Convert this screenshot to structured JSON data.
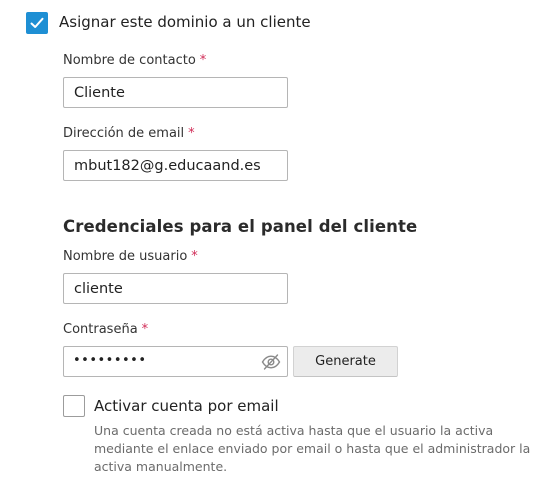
{
  "assign_client": {
    "checked": true,
    "label": "Asignar este dominio a un cliente"
  },
  "required_mark": "*",
  "contact_name": {
    "label": "Nombre de contacto",
    "value": "Cliente"
  },
  "email": {
    "label": "Dirección de email",
    "value": "mbut182@g.educaand.es"
  },
  "credentials": {
    "title": "Credenciales para el panel del cliente",
    "username": {
      "label": "Nombre de usuario",
      "value": "cliente"
    },
    "password": {
      "label": "Contraseña",
      "masked_value": "•••••••••",
      "toggle_icon": "eye-slash-icon"
    },
    "generate_label": "Generate"
  },
  "activate_by_email": {
    "checked": false,
    "label": "Activar cuenta por email",
    "hint_lines": [
      "Una cuenta creada no está activa hasta que el usuario la activa",
      "mediante el enlace enviado por email o hasta que el administrador la",
      "activa manualmente."
    ]
  },
  "colors": {
    "accent": "#1e8fd4",
    "required": "#d12c57",
    "hint_text": "#6b6b6b",
    "button_bg": "#ececec"
  }
}
